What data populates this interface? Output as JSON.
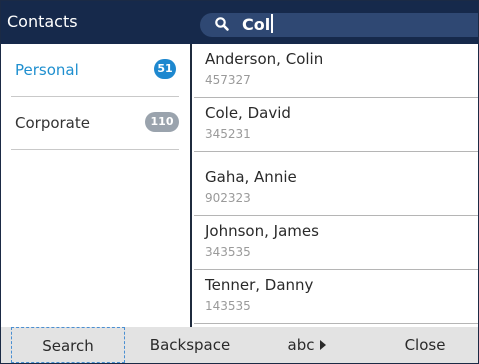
{
  "header": {
    "title": "Contacts",
    "search_value": "Col"
  },
  "sidebar": {
    "items": [
      {
        "label": "Personal",
        "count": "51",
        "active": true
      },
      {
        "label": "Corporate",
        "count": "110",
        "active": false
      }
    ]
  },
  "contacts": [
    {
      "name": "Anderson, Colin",
      "number": "457327"
    },
    {
      "name": "Cole, David",
      "number": "345231"
    },
    {
      "name": "Gaha, Annie",
      "number": "902323"
    },
    {
      "name": "Johnson, James",
      "number": "343535"
    },
    {
      "name": "Tenner, Danny",
      "number": "143535"
    }
  ],
  "softkeys": {
    "search": "Search",
    "backspace": "Backspace",
    "abc": "abc",
    "close": "Close"
  },
  "colors": {
    "header_bg": "#16294b",
    "search_bg": "#2f4873",
    "accent": "#1f8fcf",
    "badge_active": "#1e88cf",
    "badge_inactive": "#9aa3ad",
    "softkey_bar": "#e3e3e3"
  },
  "icons": {
    "search": "search-icon",
    "abc_arrow": "arrow-right-icon"
  }
}
